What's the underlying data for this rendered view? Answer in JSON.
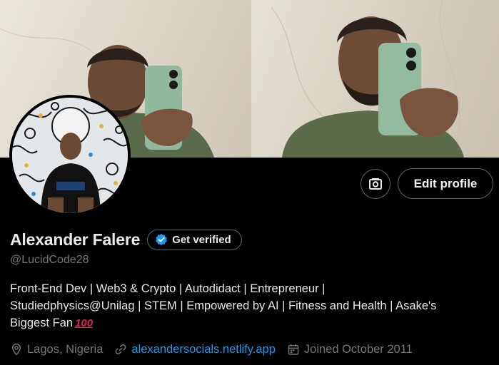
{
  "profile": {
    "display_name": "Alexander Falere",
    "handle": "@LucidCode28",
    "verify_label": "Get verified",
    "edit_label": "Edit profile",
    "bio_line1": "Front-End Dev | Web3 & Crypto | Autodidact | Entrepreneur |",
    "bio_line2": "Studiedphysics@Unilag | STEM | Empowered by AI | Fitness and Health | Asake's",
    "bio_line3": "Biggest Fan",
    "bio_emoji": "100",
    "location": "Lagos, Nigeria",
    "website": "alexandersocials.netlify.app",
    "joined": "Joined October 2011"
  },
  "icons": {
    "banner_button": "camera-switch-icon",
    "verify": "verified-badge-icon",
    "location": "location-pin-icon",
    "link": "link-icon",
    "calendar": "calendar-icon"
  },
  "colors": {
    "background": "#000000",
    "text_primary": "#e7e9ea",
    "text_secondary": "#71767b",
    "link": "#1d9bf0",
    "verified_blue": "#1d9bf0",
    "border": "#536471"
  }
}
